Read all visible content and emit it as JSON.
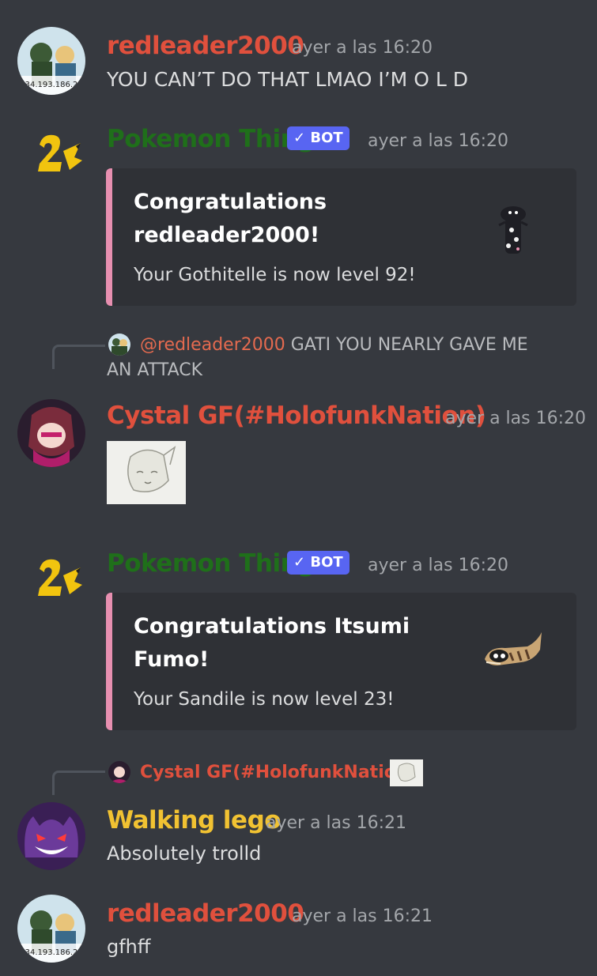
{
  "colors": {
    "background": "#36393f",
    "embed_background": "#2f3136",
    "embed_accent": "#e78fb0",
    "redleader": "#e0503d",
    "pokemon_thing": "#1f6f1a",
    "cystal": "#e0503d",
    "walking_lego": "#f1c232",
    "bot_badge": "#5865f2"
  },
  "messages": [
    {
      "author": "redleader2000",
      "timestamp": "ayer a las 16:20",
      "text": "YOU CAN’T DO THAT LMAO I’M O L D",
      "avatar_caption": "34.193.186.2"
    },
    {
      "author": "Pokemon Thing",
      "bot_badge": "BOT",
      "timestamp": "ayer a las 16:20",
      "embed": {
        "title": "Congratulations redleader2000!",
        "description": "Your Gothitelle is now level 92!"
      }
    },
    {
      "reply": {
        "mention": "@redleader2000",
        "text": "GATI YOU NEARLY GAVE ME",
        "text_line2": "AN ATTACK"
      },
      "author": "Cystal GF(#HolofunkNation)",
      "timestamp": "ayer a las 16:20"
    },
    {
      "author": "Pokemon Thing",
      "bot_badge": "BOT",
      "timestamp": "ayer a las 16:20",
      "embed": {
        "title": "Congratulations Itsumi Fumo!",
        "description": "Your Sandile is now level 23!"
      }
    },
    {
      "reply": {
        "author": "Cystal GF(#HolofunkNation)"
      },
      "author": "Walking lego",
      "timestamp": "ayer a las 16:21",
      "text": "Absolutely trolld"
    },
    {
      "author": "redleader2000",
      "timestamp": "ayer a las 16:21",
      "text": "gfhff",
      "avatar_caption": "34.193.186.2"
    }
  ]
}
